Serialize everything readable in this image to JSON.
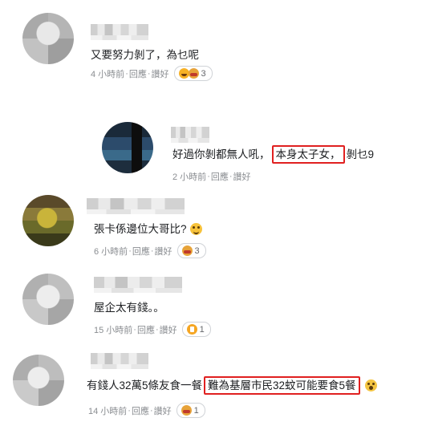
{
  "comments": [
    {
      "text": "又要努力剝了，為乜呢",
      "time": "4 小時前",
      "reply": "回應",
      "like": "讚好",
      "reaction_count": "3"
    },
    {
      "text_before": "好過你剝都無人吼，",
      "text_highlight": "本身太子女，",
      "text_after": "剝乜9",
      "time": "2 小時前",
      "reply": "回應",
      "like": "讚好"
    },
    {
      "text": "張卡係邊位大哥比?",
      "time": "6 小時前",
      "reply": "回應",
      "like": "讚好",
      "reaction_count": "3"
    },
    {
      "text": "屋企太有錢。。",
      "time": "15 小時前",
      "reply": "回應",
      "like": "讚好",
      "reaction_count": "1"
    },
    {
      "text_before": "有錢人32萬5條友食一餐",
      "text_highlight": "難為基層市民32蚊可能要食5餐",
      "time": "14 小時前",
      "reply": "回應",
      "like": "讚好",
      "reaction_count": "1"
    }
  ],
  "separators": {
    "comma": "，",
    "period": "。",
    "dot": "·"
  },
  "reaction_icons": [
    "haha-wow-emoji",
    "care-emoji",
    "like-emoji",
    "care-emoji"
  ]
}
